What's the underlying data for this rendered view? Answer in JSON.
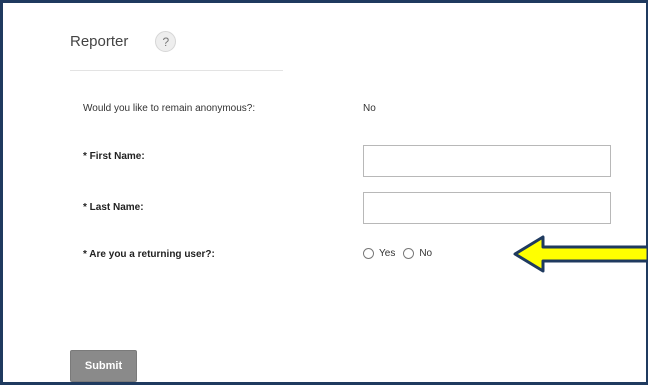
{
  "section": {
    "title": "Reporter",
    "help_glyph": "?"
  },
  "form": {
    "anonymous": {
      "label": "Would you like to remain anonymous?:",
      "value": "No"
    },
    "first_name": {
      "label": "* First Name:",
      "value": ""
    },
    "last_name": {
      "label": "* Last Name:",
      "value": ""
    },
    "returning_user": {
      "label": "* Are you a returning user?:",
      "options": [
        "Yes",
        "No"
      ],
      "selected": null
    }
  },
  "annotation": {
    "icon": "left-arrow-icon",
    "fill": "#ffff00",
    "outline": "#1f3a5f"
  },
  "actions": {
    "submit_label": "Submit"
  }
}
